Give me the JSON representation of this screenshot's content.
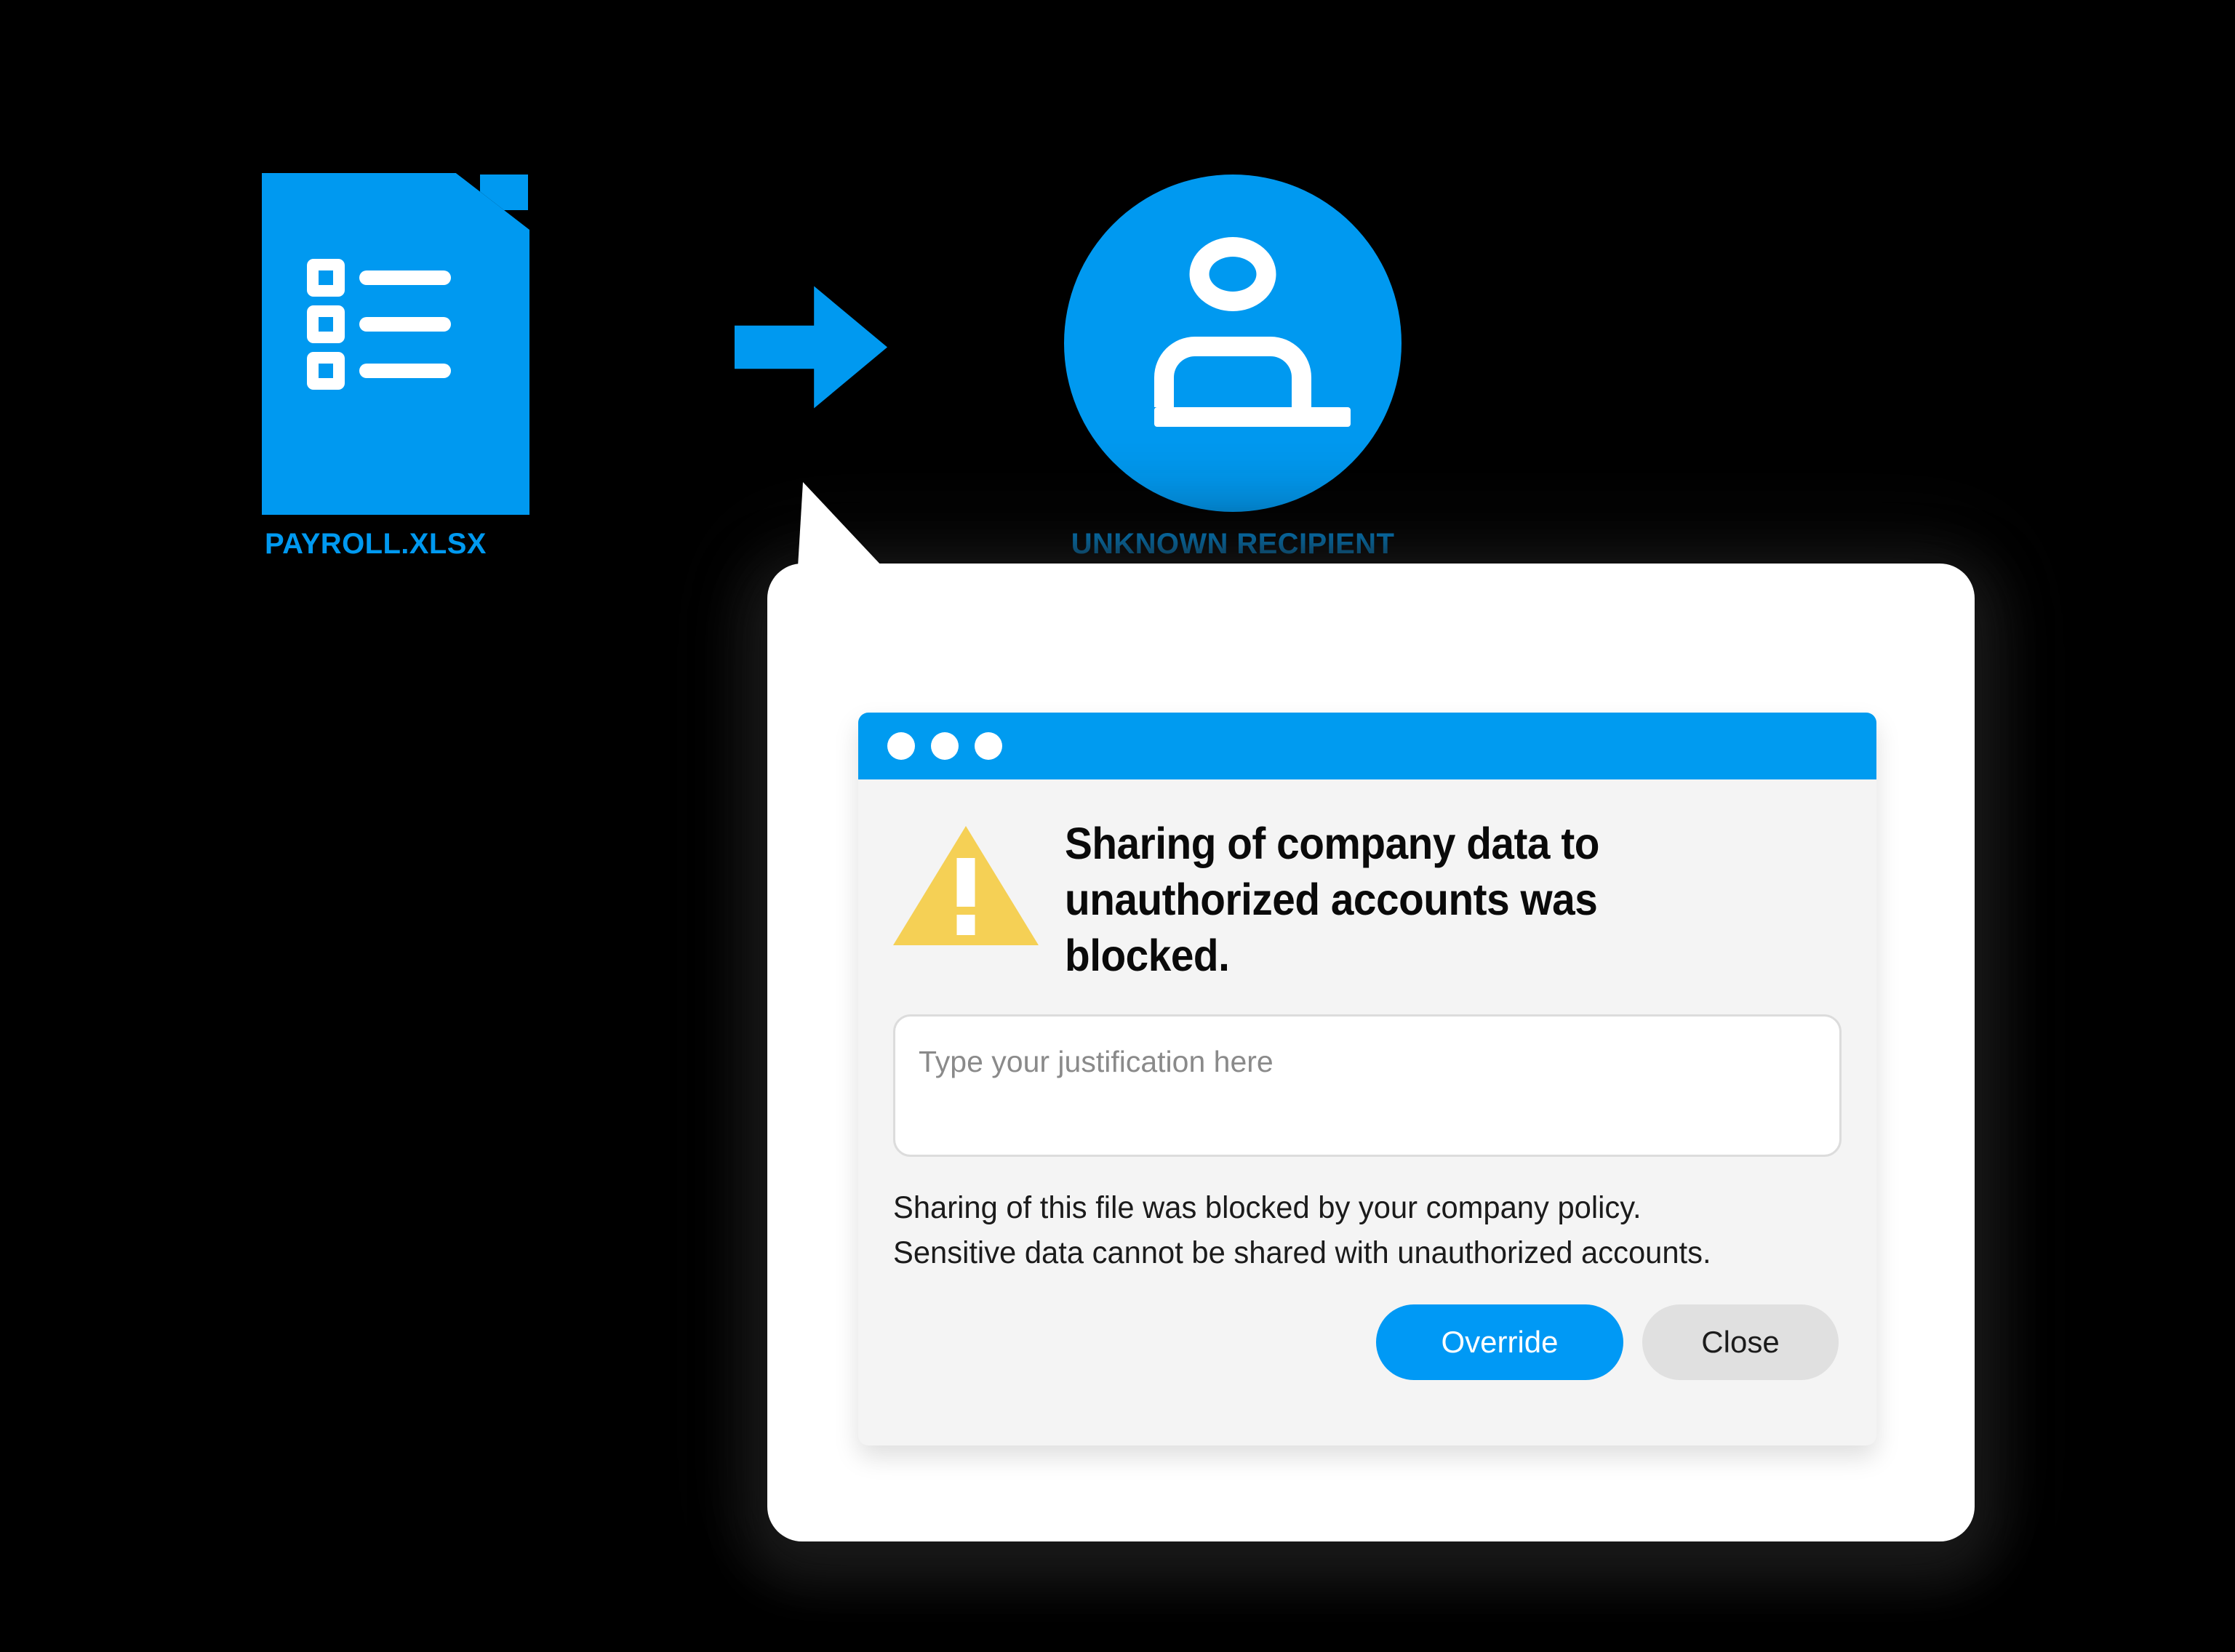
{
  "scene": {
    "file": {
      "icon": "spreadsheet-document-icon",
      "label": "PAYROLL.XLSX"
    },
    "flow_arrow": {
      "icon": "right-arrow-icon"
    },
    "recipient": {
      "icon": "person-avatar-icon",
      "label": "UNKNOWN RECIPIENT"
    }
  },
  "dialog": {
    "title_bar": {
      "dots": [
        "close-dot",
        "minimize-dot",
        "maximize-dot"
      ]
    },
    "alert": {
      "icon": "warning-triangle-icon",
      "heading": "Sharing of company data to unauthorized accounts was blocked."
    },
    "justification": {
      "value": "",
      "placeholder": "Type your justification here"
    },
    "policy_text": "Sharing of this file was blocked by your company policy.\nSensitive data cannot be shared with unauthorized accounts.",
    "buttons": {
      "primary": "Override",
      "secondary": "Close"
    }
  },
  "colors": {
    "brand_blue": "#0099F0",
    "title_bar_blue": "#009BF0",
    "button_blue": "#0099F5",
    "warning_yellow": "#F5D055",
    "dialog_bg": "#F4F4F4",
    "secondary_button": "#E0E0E0",
    "background": "#000000"
  }
}
